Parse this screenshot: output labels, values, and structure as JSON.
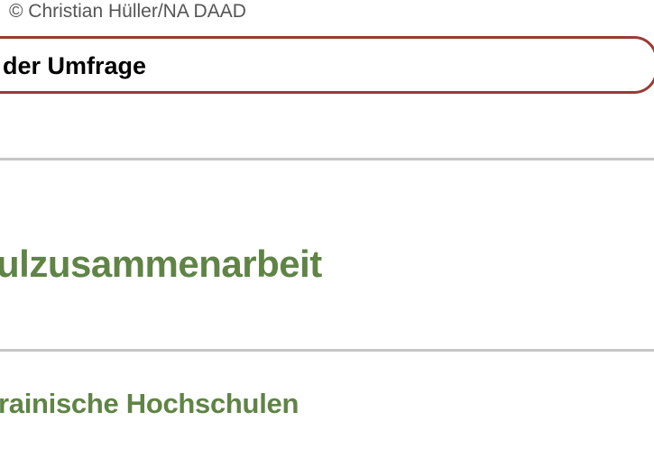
{
  "image_credit": "© Christian Hüller/NA DAAD",
  "survey_button": {
    "label": "der Umfrage",
    "border_color": "#9a3b36"
  },
  "section": {
    "heading": "ulzusammenarbeit",
    "link": "rainische Hochschulen",
    "accent_color": "#5f8446"
  }
}
